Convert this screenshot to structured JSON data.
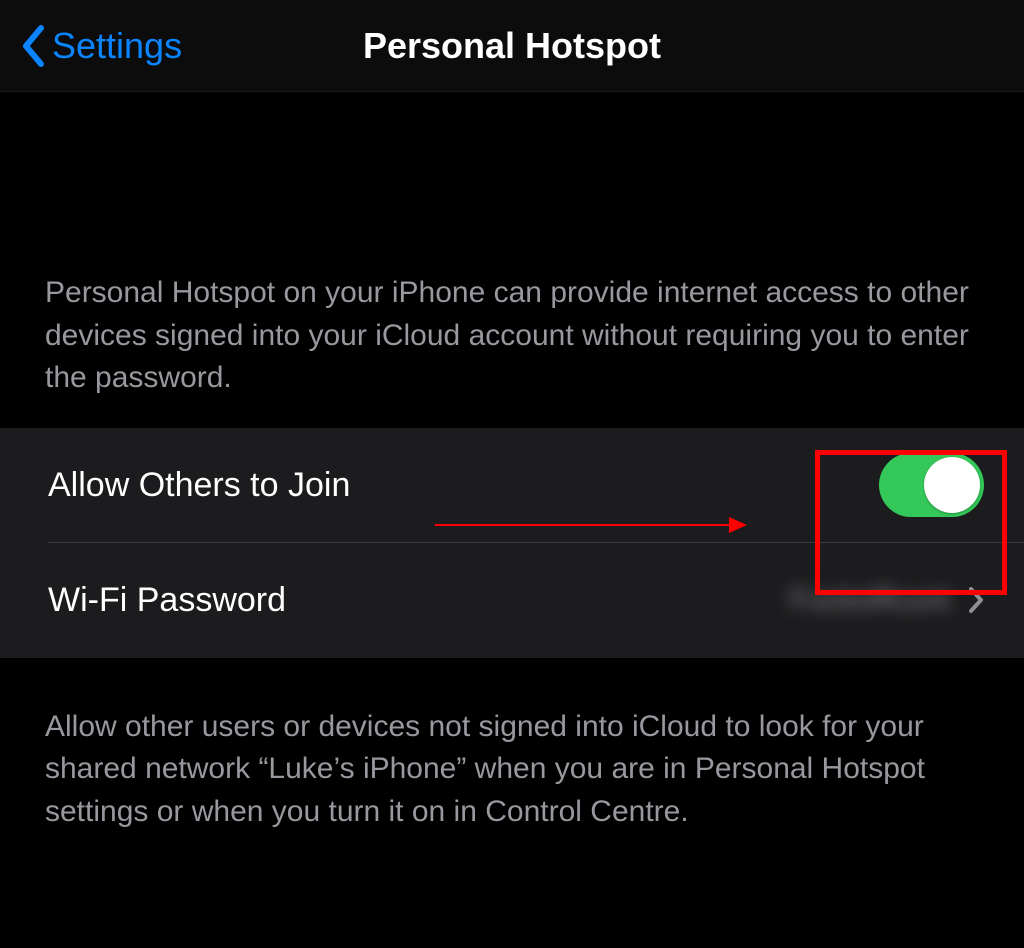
{
  "nav": {
    "back_label": "Settings",
    "title": "Personal Hotspot"
  },
  "header_text": "Personal Hotspot on your iPhone can provide internet access to other devices signed into your iCloud account without requiring you to enter the password.",
  "rows": {
    "allow_others": {
      "label": "Allow Others to Join",
      "toggle_on": true
    },
    "wifi_password": {
      "label": "Wi-Fi Password",
      "value_obscured": "Fuckoffcunt"
    }
  },
  "footer_text": "Allow other users or devices not signed into iCloud to look for your shared network “Luke’s iPhone” when you are in Personal Hotspot settings or when you turn it on in Control Centre.",
  "colors": {
    "accent_blue": "#0a84ff",
    "toggle_green": "#34c759",
    "annotation_red": "#ff0000"
  }
}
